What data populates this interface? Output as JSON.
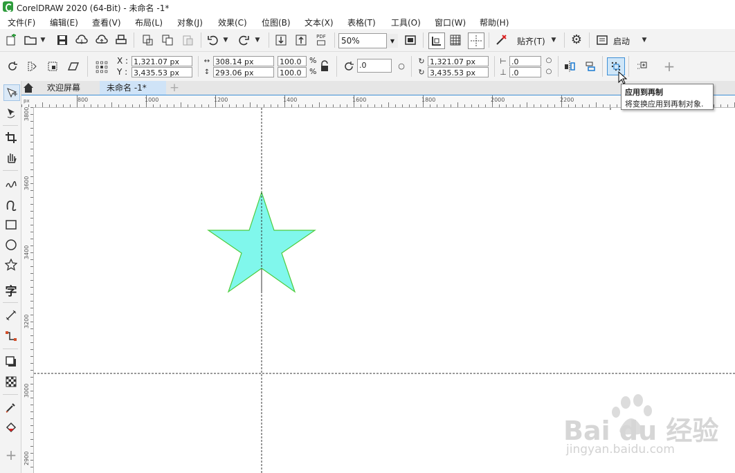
{
  "window": {
    "title": "CorelDRAW 2020 (64-Bit) - 未命名 -1*"
  },
  "menu": [
    "文件(F)",
    "编辑(E)",
    "查看(V)",
    "布局(L)",
    "对象(J)",
    "效果(C)",
    "位图(B)",
    "文本(X)",
    "表格(T)",
    "工具(O)",
    "窗口(W)",
    "帮助(H)"
  ],
  "toolbar": {
    "zoom": "50%",
    "pdf_label": "PDF",
    "snap_label": "贴齐(T)",
    "launch_label": "启动"
  },
  "property_bar": {
    "x_label": "X :",
    "y_label": "Y :",
    "x_value": "1,321.07 px",
    "y_value": "3,435.53 px",
    "width_value": "308.14 px",
    "height_value": "293.06 px",
    "scale_w": "100.0",
    "scale_h": "100.0",
    "percent": "%",
    "rotation": ".0",
    "center_x": "1,321.07 px",
    "center_y": "3,435.53 px",
    "skew_h": ".0",
    "skew_v": ".0"
  },
  "tabs": [
    {
      "label": "欢迎屏幕",
      "active": false
    },
    {
      "label": "未命名 -1*",
      "active": true
    }
  ],
  "ruler": {
    "h_labels": [
      "800",
      "1000",
      "1200",
      "1400",
      "1600",
      "1800",
      "2000",
      "2200"
    ],
    "v_labels": [
      "3800",
      "3600",
      "3400",
      "3200",
      "3000",
      "2900"
    ],
    "corner": "px"
  },
  "tooltip": {
    "title": "应用到再制",
    "description": "将变换应用到再制对象."
  },
  "star": {
    "fill": "#80f7ec",
    "stroke": "#4ccc3c"
  },
  "colors": {
    "accent": "#2e9c3c",
    "active_tab": "#cfe3f7"
  },
  "watermark": {
    "brand": "Bai du 经验",
    "url": "jingyan.baidu.com"
  }
}
